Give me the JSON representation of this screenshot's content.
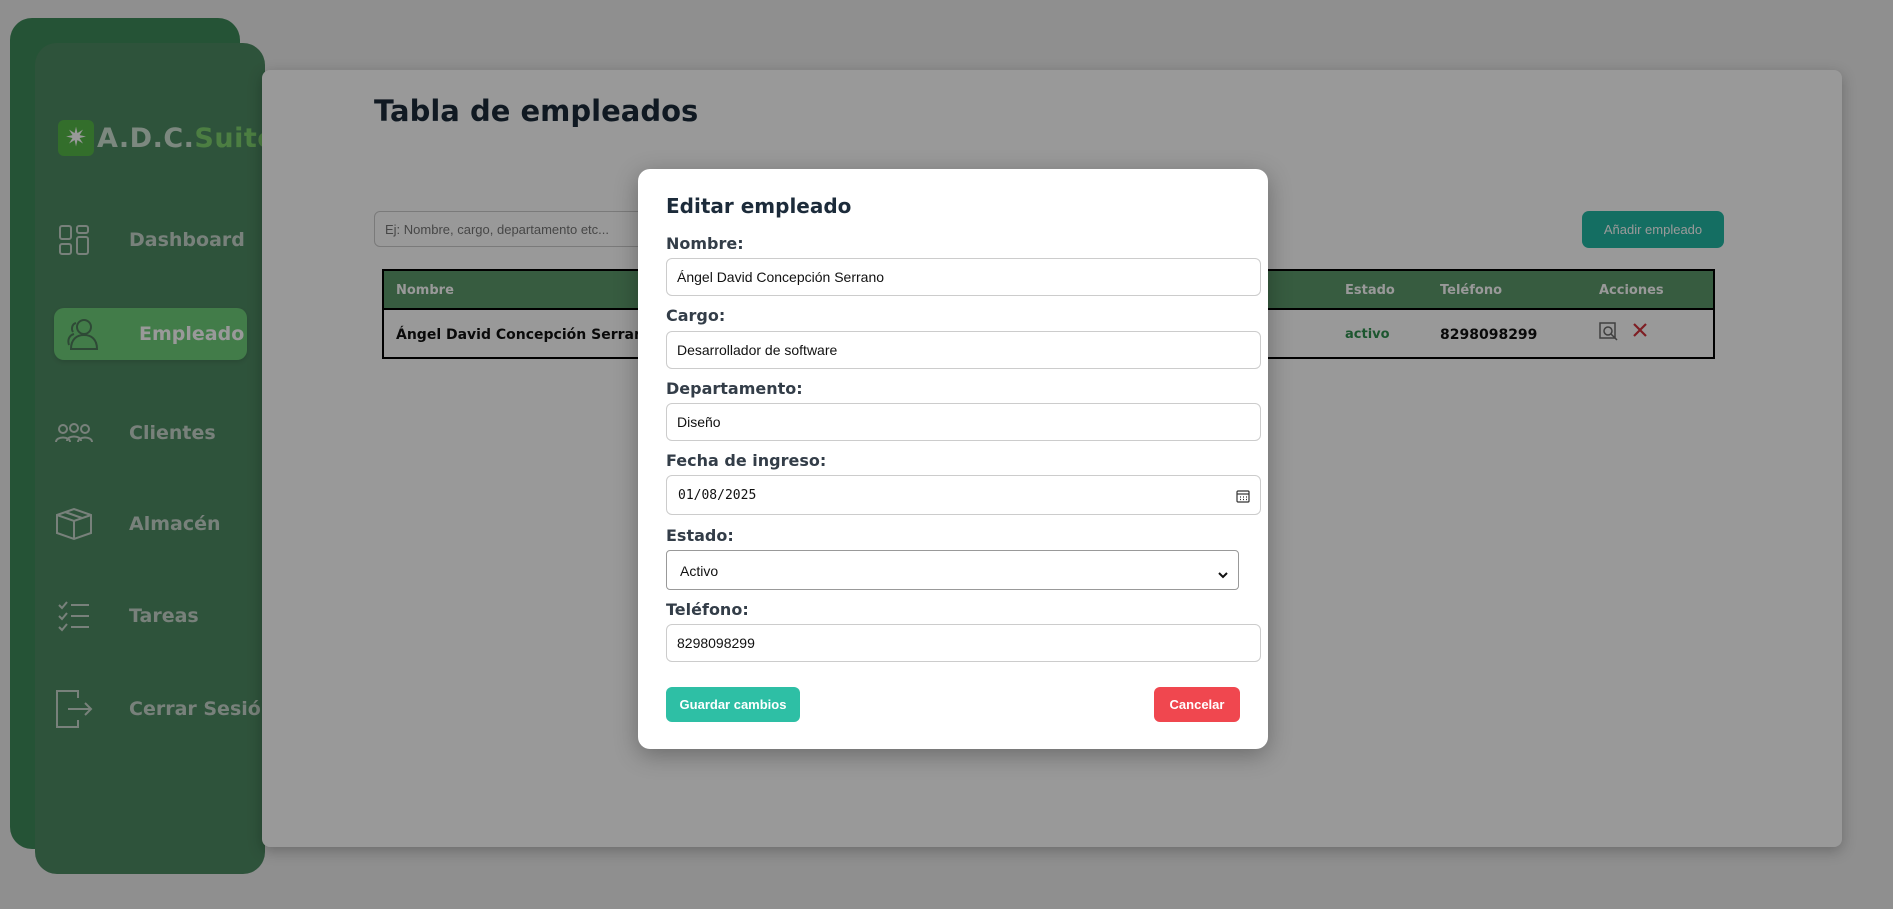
{
  "app": {
    "logo_adc": "A.D.C.",
    "logo_suite": "Suite",
    "logo_icon": "starburst-icon"
  },
  "sidebar": {
    "items": [
      {
        "label": "Dashboard",
        "icon": "dashboard-grid-icon",
        "active": false
      },
      {
        "label": "Empleado",
        "icon": "user-icon",
        "active": true
      },
      {
        "label": "Clientes",
        "icon": "users-group-icon",
        "active": false
      },
      {
        "label": "Almacén",
        "icon": "box-icon",
        "active": false
      },
      {
        "label": "Tareas",
        "icon": "checklist-icon",
        "active": false
      },
      {
        "label": "Cerrar Sesión",
        "icon": "logout-icon",
        "active": false
      }
    ]
  },
  "main": {
    "title": "Tabla de empleados",
    "search_placeholder": "Ej: Nombre, cargo, departamento etc...",
    "add_button": "Añadir empleado",
    "table": {
      "headers": {
        "nombre": "Nombre",
        "estado": "Estado",
        "telefono": "Teléfono",
        "acciones": "Acciones"
      },
      "rows": [
        {
          "nombre": "Ángel David Concepción Serrano",
          "estado": "activo",
          "telefono": "8298098299",
          "actions": [
            "edit-icon",
            "delete-icon"
          ]
        }
      ]
    }
  },
  "modal": {
    "title": "Editar empleado",
    "fields": {
      "nombre": {
        "label": "Nombre:",
        "value": "Ángel David Concepción Serrano"
      },
      "cargo": {
        "label": "Cargo:",
        "value": "Desarrollador de software"
      },
      "departamento": {
        "label": "Departamento:",
        "value": "Diseño"
      },
      "fecha": {
        "label": "Fecha de ingreso:",
        "value": "01/08/2025"
      },
      "estado": {
        "label": "Estado:",
        "value": "Activo"
      },
      "telefono": {
        "label": "Teléfono:",
        "value": "8298098299"
      }
    },
    "save_button": "Guardar cambios",
    "cancel_button": "Cancelar"
  },
  "colors": {
    "sidebar": "#4e8a63",
    "sidebar_active": "#6fcf7a",
    "teal_button": "#22b8a4",
    "danger": "#f0474f",
    "status_active": "#2f8f4f"
  }
}
